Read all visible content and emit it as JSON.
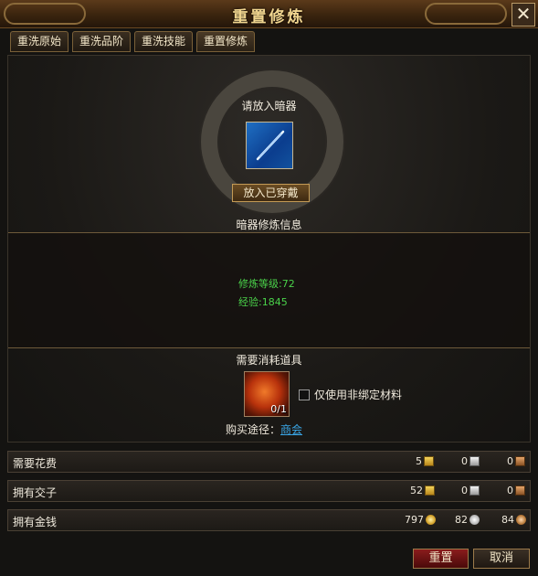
{
  "window": {
    "title": "重置修炼",
    "close_label": "✕"
  },
  "tabs": [
    {
      "label": "重洗原始"
    },
    {
      "label": "重洗品阶"
    },
    {
      "label": "重洗技能"
    },
    {
      "label": "重置修炼"
    }
  ],
  "equip": {
    "prompt": "请放入暗器",
    "slot_icon": "needle-icon",
    "place_button": "放入已穿戴"
  },
  "info": {
    "title": "暗器修炼信息",
    "level": "修炼等级:72",
    "exp": "经验:1845"
  },
  "consume": {
    "title": "需要消耗道具",
    "item_icon": "fire-orb-icon",
    "item_count": "0/1",
    "checkbox_label": "仅使用非绑定材料",
    "buy_prefix": "购买途径：",
    "buy_link": "商会"
  },
  "rows": {
    "cost": {
      "label": "需要花费",
      "gold": "5",
      "silver": "0",
      "bronze": "0"
    },
    "jiaozi": {
      "label": "拥有交子",
      "gold": "52",
      "silver": "0",
      "bronze": "0"
    },
    "money": {
      "label": "拥有金钱",
      "gold": "797",
      "silver": "82",
      "bronze": "84"
    }
  },
  "buttons": {
    "reset": "重置",
    "cancel": "取消"
  },
  "colors": {
    "stat_green": "#4ad24a",
    "link_blue": "#3aa6e6",
    "title_gold": "#f0d58f"
  }
}
